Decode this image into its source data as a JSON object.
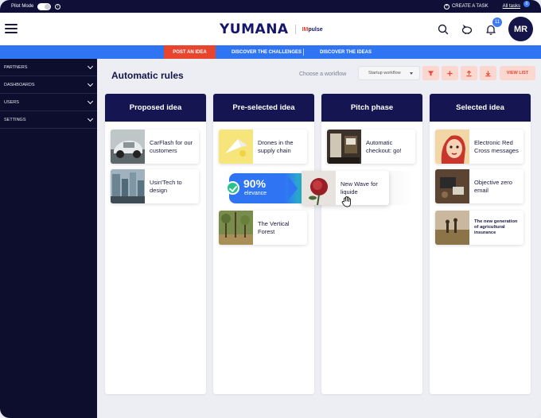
{
  "topbar": {
    "pilot_label": "Pilot Mode",
    "create_task": "CREATE A TASK",
    "all_tasks": "All tasks",
    "all_tasks_count": "0"
  },
  "header": {
    "logo_main": "YUMANA",
    "logo_sub_prefix": "IM",
    "logo_sub_suffix": "pulse",
    "notifications_count": "11",
    "avatar_initials": "MR"
  },
  "nav": {
    "post_idea": "POST AN IDEA",
    "challenges": "DISCOVER THE CHALLENGES",
    "ideas": "DISCOVER THE IDEAS"
  },
  "sidebar": {
    "items": [
      {
        "label": "PARTNERS"
      },
      {
        "label": "DASHBOARDS"
      },
      {
        "label": "USERS"
      },
      {
        "label": "SETTINGS"
      }
    ]
  },
  "main": {
    "title": "Automatic rules",
    "choose_workflow": "Choose a workflow",
    "workflow_selected": "Startup workflow",
    "view_list": "VIEW LIST"
  },
  "columns": [
    {
      "title": "Proposed idea",
      "cards": [
        "CarFlash for our customers",
        "Usin'Tech to design"
      ]
    },
    {
      "title": "Pre-selected idea",
      "cards": [
        "Drones in the supply chain",
        "The Vertical Forest"
      ]
    },
    {
      "title": "Pitch phase",
      "cards": [
        "Automatic checkout: go!"
      ]
    },
    {
      "title": "Selected idea",
      "cards": [
        "Electronic Red Cross messages",
        "Objective zero email",
        "The new generation of agricultural insurance"
      ]
    }
  ],
  "drag": {
    "percent": "90%",
    "label": "elevance",
    "card_title": "New Wave for liquide"
  },
  "colors": {
    "navy": "#0f0f37",
    "accent_blue": "#2f74f3",
    "accent_red": "#e8452f",
    "teal": "#27d1b4"
  }
}
